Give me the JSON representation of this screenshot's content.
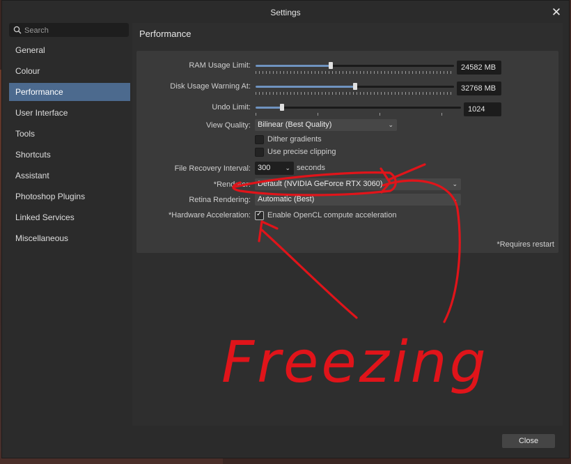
{
  "window": {
    "title": "Settings"
  },
  "search": {
    "placeholder": "Search"
  },
  "sidebar": {
    "items": [
      {
        "label": "General"
      },
      {
        "label": "Colour"
      },
      {
        "label": "Performance",
        "active": true
      },
      {
        "label": "User Interface"
      },
      {
        "label": "Tools"
      },
      {
        "label": "Shortcuts"
      },
      {
        "label": "Assistant"
      },
      {
        "label": "Photoshop Plugins"
      },
      {
        "label": "Linked Services"
      },
      {
        "label": "Miscellaneous"
      }
    ]
  },
  "page": {
    "title": "Performance"
  },
  "settings": {
    "ram": {
      "label": "RAM Usage Limit:",
      "value": "24582 MB",
      "fraction": 0.38
    },
    "disk": {
      "label": "Disk Usage Warning At:",
      "value": "32768 MB",
      "fraction": 0.5
    },
    "undo": {
      "label": "Undo Limit:",
      "value": "1024",
      "fraction": 0.13
    },
    "view_quality": {
      "label": "View Quality:",
      "value": "Bilinear (Best Quality)"
    },
    "dither": {
      "label": "Dither gradients",
      "checked": false
    },
    "precise_clipping": {
      "label": "Use precise clipping",
      "checked": false
    },
    "file_recovery": {
      "label": "File Recovery Interval:",
      "value": "300",
      "unit": "seconds"
    },
    "renderer": {
      "label": "*Renderer:",
      "value": "Default (NVIDIA GeForce RTX 3060)"
    },
    "retina": {
      "label": "Retina Rendering:",
      "value": "Automatic (Best)"
    },
    "hw_accel": {
      "label": "*Hardware Acceleration:",
      "option": "Enable OpenCL compute acceleration",
      "checked": true
    },
    "restart_note": "*Requires restart"
  },
  "buttons": {
    "close": "Close"
  },
  "annotation": {
    "text": "Freezing",
    "color": "#e0141a"
  },
  "colors": {
    "accent": "#4c6a8e",
    "slider_fill": "#6f93c0"
  }
}
